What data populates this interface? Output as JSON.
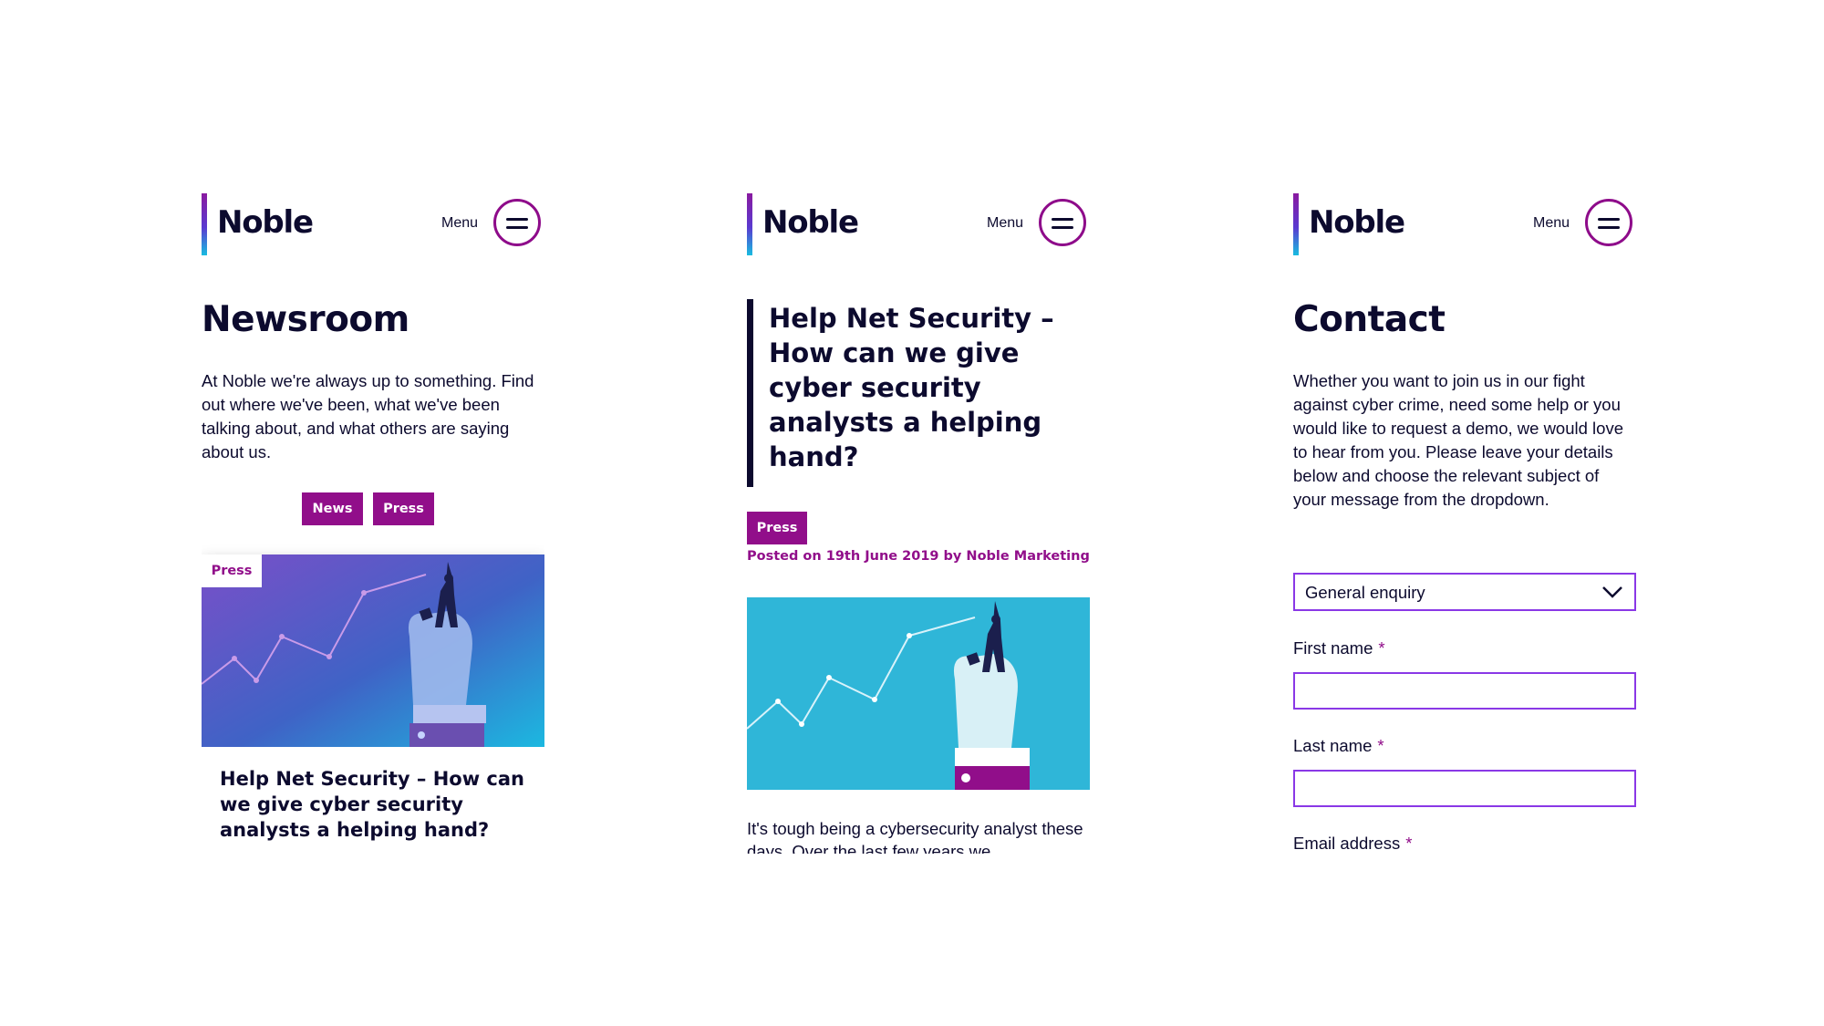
{
  "brand": {
    "name": "Noble",
    "menu_label": "Menu"
  },
  "colors": {
    "accent": "#910e8a",
    "text": "#0c0a2e",
    "input_border": "#8a38e6",
    "illustration_bg": "#2fb6d8"
  },
  "newsroom": {
    "title": "Newsroom",
    "intro": "At Noble we're always up to something. Find out where we've been, what we've been talking about, and what others are saying about us.",
    "filters": [
      "News",
      "Press"
    ],
    "card": {
      "tag": "Press",
      "title": "Help Net Security – How can we give cyber security analysts a helping hand?"
    }
  },
  "article": {
    "title": "Help Net Security – How can we give cyber security analysts a helping hand?",
    "tag": "Press",
    "meta": "Posted on 19th June 2019 by Noble Marketing",
    "body": "It's tough being a cybersecurity analyst these days. Over the last few years we"
  },
  "contact": {
    "title": "Contact",
    "intro": "Whether you want to join us in our fight against cyber crime, need some help or you would like to request a demo, we would love to hear from you. Please leave your details below and choose the relevant subject of your message from the dropdown.",
    "subject_value": "General enquiry",
    "fields": [
      {
        "label": "First name",
        "required_mark": "*"
      },
      {
        "label": "Last name",
        "required_mark": "*"
      },
      {
        "label": "Email address",
        "required_mark": "*"
      }
    ]
  }
}
